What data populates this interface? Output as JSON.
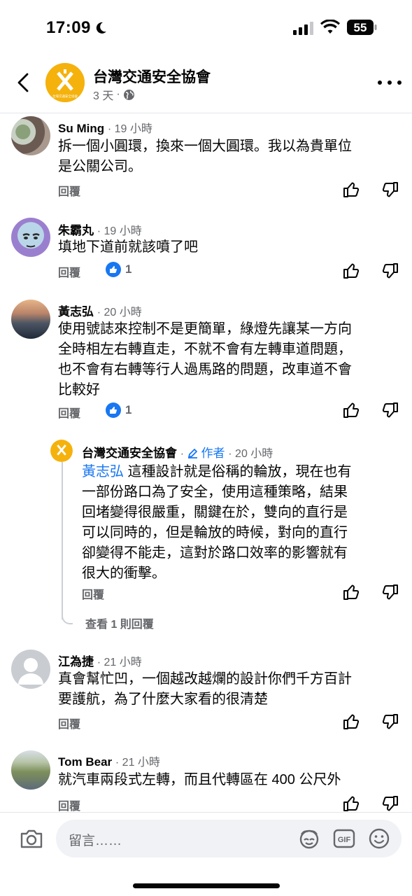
{
  "status_bar": {
    "time": "17:09",
    "battery": "55"
  },
  "header": {
    "page_name": "台灣交通安全協會",
    "post_age": "3 天",
    "separator": "·",
    "logo_caption": "台灣交通安全協會"
  },
  "actions": {
    "reply": "回覆",
    "view_replies": "查看 1 則回覆"
  },
  "comments": [
    {
      "author": "Su Ming",
      "time": "· 19 小時",
      "lines": [
        "拆一個小圓環，換來一個大圓環。我以為貴單位",
        "是公關公司。"
      ],
      "likes": ""
    },
    {
      "author": "朱霸丸",
      "time": "· 19 小時",
      "lines": [
        "填地下道前就該噴了吧"
      ],
      "likes": "1"
    },
    {
      "author": "黃志弘",
      "time": "· 20 小時",
      "lines": [
        "使用號誌來控制不是更簡單，綠燈先讓某一方向",
        "全時相左右轉直走，不就不會有左轉車道問題，",
        "也不會有右轉等行人過馬路的問題，改車道不會",
        "比較好"
      ],
      "likes": "1"
    },
    {
      "author": "江為捷",
      "time": "· 21 小時",
      "lines": [
        "真會幫忙凹，一個越改越爛的設計你們千方百計",
        "要護航，為了什麼大家看的很清楚"
      ],
      "likes": ""
    },
    {
      "author": "Tom Bear",
      "time": "· 21 小時",
      "lines": [
        "就汽車兩段式左轉，而且代轉區在 400 公尺外"
      ],
      "likes": ""
    }
  ],
  "reply": {
    "author": "台灣交通安全協會",
    "separator": "·",
    "badge": "作者",
    "time": "· 20 小時",
    "mention": "黃志弘",
    "lines": [
      " 這種設計就是俗稱的輪放，現在也有",
      "一部份路口為了安全，使用這種策略，結果",
      "回堵變得很嚴重，關鍵在於，雙向的直行是",
      "可以同時的，但是輪放的時候，對向的直行",
      "卻變得不能走，這對於路口效率的影響就有",
      "很大的衝擊。"
    ]
  },
  "composer": {
    "placeholder": "留言……",
    "gif_label": "GIF"
  },
  "colors": {
    "accent": "#1877f2",
    "muted": "#65676b",
    "logo": "#f5b20c"
  },
  "icons": [
    "back-arrow-icon",
    "more-icon",
    "thumbs-up-icon",
    "thumbs-down-icon",
    "like-badge-icon",
    "camera-icon",
    "sticker-icon",
    "gif-icon",
    "emoji-icon",
    "pencil-icon",
    "globe-icon",
    "moon-icon",
    "signal-icon",
    "wifi-icon",
    "battery-icon"
  ]
}
